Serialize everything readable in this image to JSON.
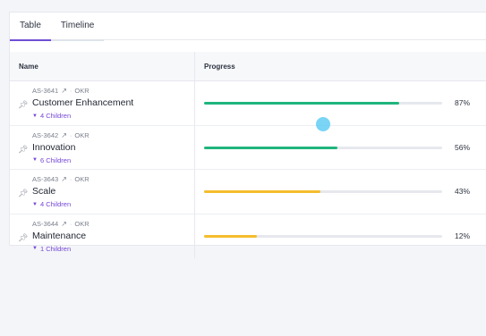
{
  "tabs": [
    {
      "label": "Table",
      "active": true
    },
    {
      "label": "Timeline",
      "active": false
    }
  ],
  "table": {
    "columns": {
      "name": "Name",
      "progress": "Progress"
    },
    "rows": [
      {
        "id": "AS-3641",
        "type": "OKR",
        "title": "Customer Enhancement",
        "children": "4 Children",
        "progress_label": "87%",
        "progress": 0.87,
        "bar_fill_fraction": 0.82,
        "color": "#1fb57d"
      },
      {
        "id": "AS-3642",
        "type": "OKR",
        "title": "Innovation",
        "children": "6 Children",
        "progress_label": "56%",
        "progress": 0.56,
        "bar_fill_fraction": 0.56,
        "color": "#1fb57d"
      },
      {
        "id": "AS-3643",
        "type": "OKR",
        "title": "Scale",
        "children": "4 Children",
        "progress_label": "43%",
        "progress": 0.43,
        "bar_fill_fraction": 0.49,
        "color": "#f5bd2c"
      },
      {
        "id": "AS-3644",
        "type": "OKR",
        "title": "Maintenance",
        "children": "1 Children",
        "progress_label": "12%",
        "progress": 0.12,
        "bar_fill_fraction": 0.22,
        "color": "#f5bd2c"
      }
    ]
  },
  "colors": {
    "accent": "#6f4fd6",
    "green": "#1fb57d",
    "yellow": "#f5bd2c"
  },
  "icons": {
    "pin": "pin-icon",
    "external": "external-link-icon",
    "caret": "caret-down-icon"
  }
}
